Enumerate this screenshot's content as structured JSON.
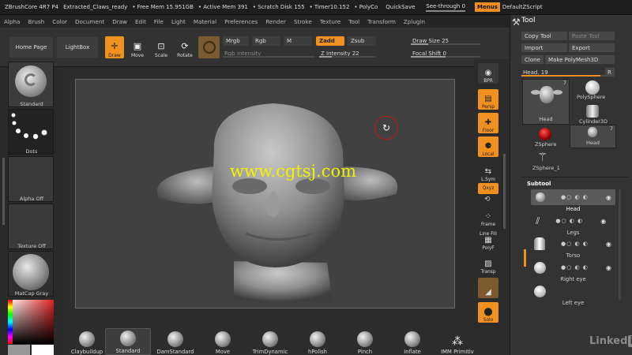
{
  "titlebar": {
    "app": "ZBrushCore 4R7 P4",
    "file": "Extracted_Claws_ready",
    "free_mem": "• Free Mem 15.951GB",
    "active_mem": "• Active Mem 391",
    "scratch": "• Scratch Disk 155",
    "timer": "• Timer10.152",
    "polyco": "• PolyCo",
    "quicksave": "QuickSave",
    "seethrough": "See-through  0",
    "menus": "Menus",
    "script": "DefaultZScript"
  },
  "menubar": [
    "Alpha",
    "Brush",
    "Color",
    "Document",
    "Draw",
    "Edit",
    "File",
    "Light",
    "Material",
    "Preferences",
    "Render",
    "Stroke",
    "Texture",
    "Tool",
    "Transform",
    "Zplugin"
  ],
  "toolbar": {
    "home": "Home Page",
    "lightbox": "LightBox",
    "draw": "Draw",
    "move": "Move",
    "scale": "Scale",
    "rotate": "Rotate",
    "mrgb": "Mrgb",
    "rgb": "Rgb",
    "m": "M",
    "zadd": "Zadd",
    "zsub": "Zsub",
    "rgb_intensity": "Rgb Intensity",
    "z_intensity": "Z Intensity 22",
    "draw_size": "Draw Size 25",
    "focal_shift": "Focal Shift 0"
  },
  "levels": {
    "z_intensity": 0.22,
    "draw_size": 0.25,
    "focal_shift": 0.5
  },
  "left": {
    "standard": "Standard",
    "dots": "Dots",
    "alpha": "Alpha Off",
    "texture": "Texture Off",
    "matcap": "MatCap Gray"
  },
  "right_shelf": {
    "bpr": "BPR",
    "persp": "Persp",
    "floor": "Floor",
    "local": "Local",
    "lsym": "L.Sym",
    "xyz": "Qxyz",
    "frame": "Frame",
    "linefill": "Line Fill",
    "polyf": "PolyF",
    "transp": "Transp",
    "solo": "Solo"
  },
  "tool": {
    "title": "Tool",
    "copy": "Copy Tool",
    "paste": "Paste Tool",
    "import": "Import",
    "export": "Export",
    "clone": "Clone",
    "make": "Make PolyMesh3D",
    "head_slider": "Head. 19",
    "r": "R",
    "thumbs": [
      "Head",
      "PolySphere",
      "Cylinder3D",
      "ZSphere",
      "Head",
      "ZSphere_1"
    ],
    "count_head": "7",
    "count_head2": "7"
  },
  "subtool": {
    "title": "Subtool",
    "items": [
      "Head",
      "Legs",
      "Torso",
      "Right eye",
      "Left eye"
    ]
  },
  "brushes": [
    "Claybuildup",
    "Standard",
    "DamStandard",
    "Move",
    "TrimDynamic",
    "hPolish",
    "Pinch",
    "Inflate",
    "IMM Primitiv"
  ],
  "watermark": "www.cgtsj.com",
  "linkedin": "Linked",
  "colors": {
    "accent": "#f0901f",
    "panel": "#333333",
    "watermark": "#f2f200"
  }
}
